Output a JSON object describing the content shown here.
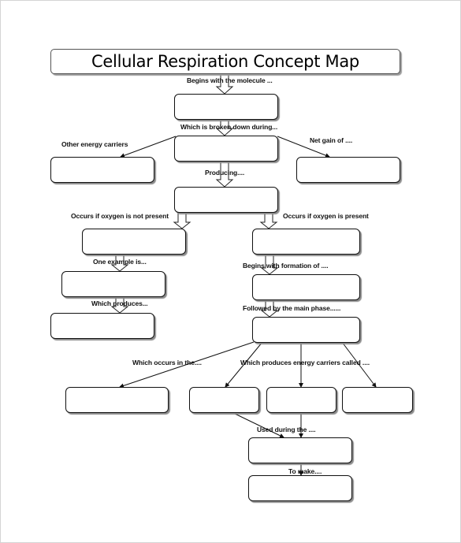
{
  "title": "Cellular Respiration Concept Map",
  "labels": {
    "begins_with_molecule": "Begins with the molecule ...",
    "broken_down_during": "Which is broken down during...",
    "other_energy_carriers": "Other energy carriers",
    "net_gain_of": "Net gain of ....",
    "producing": "Producing....",
    "oxygen_not_present": "Occurs if oxygen is not present",
    "oxygen_present": "Occurs if oxygen is present",
    "one_example_is": "One example is...",
    "which_produces": "Which produces...",
    "begins_with_formation": "Begins with formation of ....",
    "followed_by_main_phase": "Followed by the main phase......",
    "which_occurs_in": "Which occurs in the....",
    "produces_energy_carriers": "Which produces energy carriers called ....",
    "used_during": "Used during the ....",
    "to_make": "To make...."
  },
  "boxes": {
    "molecule": "",
    "breakdown_process": "",
    "other_energy_carriers": "",
    "net_gain": "",
    "product": "",
    "anaerobic": "",
    "anaerobic_example": "",
    "anaerobic_product": "",
    "aerobic": "",
    "formation": "",
    "main_phase": "",
    "location": "",
    "carrier_1": "",
    "carrier_2": "",
    "carrier_3": "",
    "used_during": "",
    "to_make": ""
  }
}
